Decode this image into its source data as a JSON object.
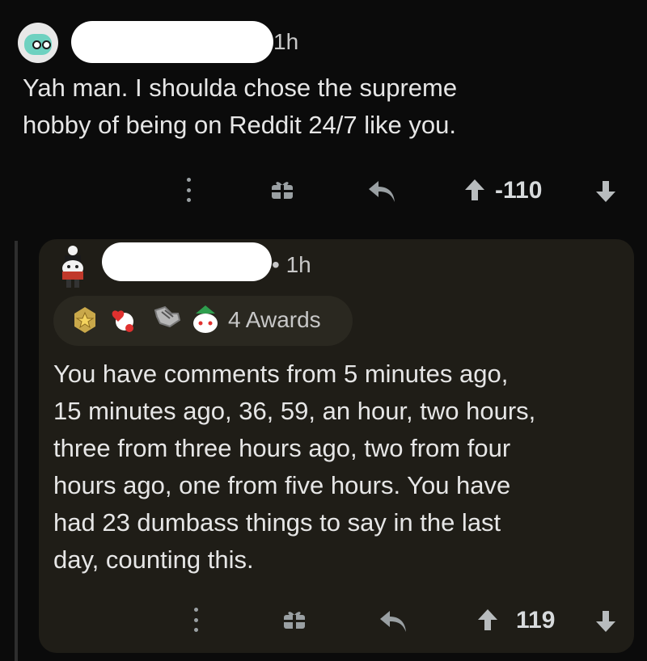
{
  "top_comment": {
    "time": "1h",
    "body_lines": [
      "Yah man. I shoulda chose the supreme",
      "hobby of being on Reddit 24/7 like you."
    ],
    "vote_count": "-110"
  },
  "reply": {
    "time": "• 1h",
    "awards_label": "4 Awards",
    "body_lines": [
      "You have comments from 5 minutes ago,",
      "15 minutes ago, 36, 59, an hour, two hours,",
      "three from three hours ago, two from four",
      "hours ago, one from five hours. You have",
      "had 23 dumbass things to say in the last",
      "day, counting this."
    ],
    "vote_count": "119"
  },
  "icons": {
    "more": "more-vertical-icon",
    "gift": "gift-icon",
    "reply": "reply-arrow-icon",
    "upvote": "upvote-arrow-icon",
    "downvote": "downvote-arrow-icon"
  },
  "colors": {
    "background": "#0b0b0b",
    "reply_card": "#1f1d17",
    "text": "#e6e6e6",
    "icon": "#9aa0a3"
  }
}
